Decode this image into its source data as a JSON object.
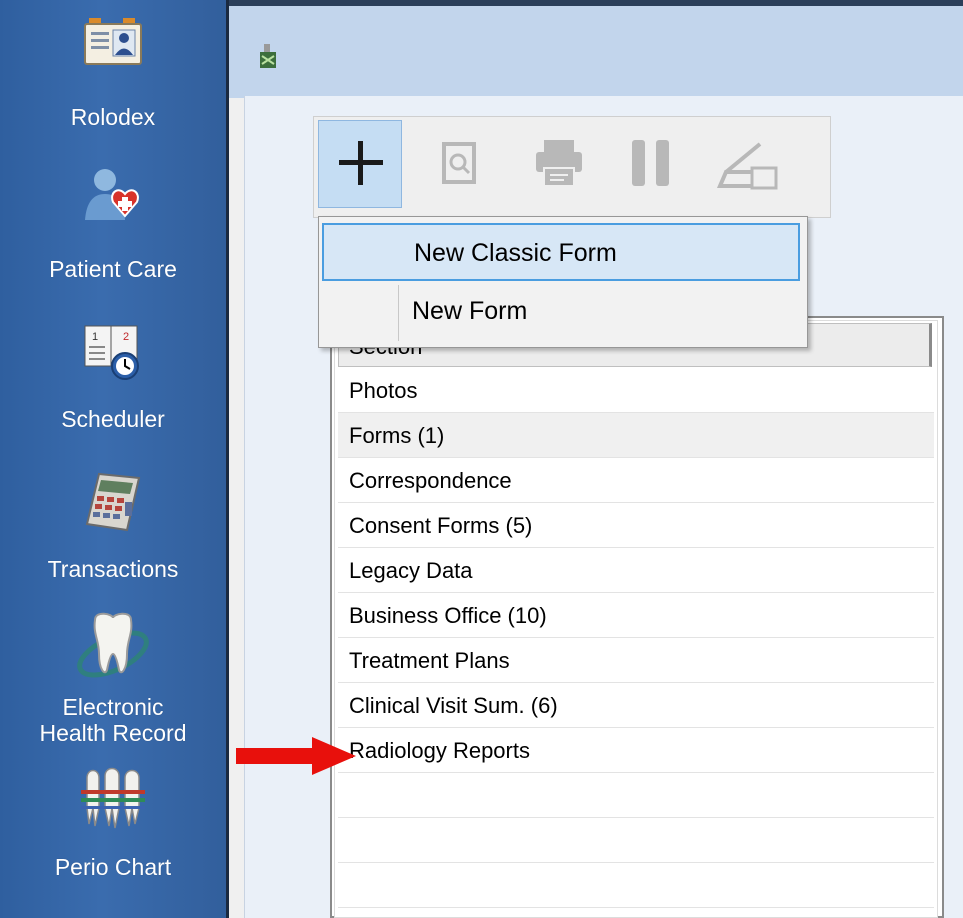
{
  "sidebar": {
    "items": [
      {
        "label": "Rolodex",
        "icon": "rolodex-card-icon"
      },
      {
        "label": "Patient Care",
        "icon": "patient-care-icon"
      },
      {
        "label": "Scheduler",
        "icon": "scheduler-clock-icon"
      },
      {
        "label": "Transactions",
        "icon": "calculator-icon"
      },
      {
        "label": "Electronic",
        "label2": "Health Record",
        "icon": "tooth-icon"
      },
      {
        "label": "Perio Chart",
        "icon": "perio-teeth-icon"
      }
    ]
  },
  "toolbar": {
    "buttons": [
      {
        "icon": "add-icon",
        "active": true
      },
      {
        "icon": "preview-icon"
      },
      {
        "icon": "print-icon"
      },
      {
        "icon": "pause-icon"
      },
      {
        "icon": "scan-icon"
      }
    ]
  },
  "menu": {
    "items": [
      {
        "label": "New Classic Form",
        "highlighted": true
      },
      {
        "label": "New Form"
      }
    ]
  },
  "list": {
    "header": "Section",
    "rows": [
      "Photos",
      "Forms (1)",
      "Correspondence",
      "Consent Forms (5)",
      "Legacy Data",
      "Business Office (10)",
      "Treatment Plans",
      "Clinical Visit Sum. (6)",
      "Radiology Reports"
    ],
    "selected_row": "Forms (1)"
  },
  "colors": {
    "sidebar": "#3a6cae",
    "header_bar": "#c2d5ec",
    "menu_highlight": "#d7e7f6",
    "menu_highlight_border": "#4a9de0",
    "arrow": "#e8100c"
  }
}
